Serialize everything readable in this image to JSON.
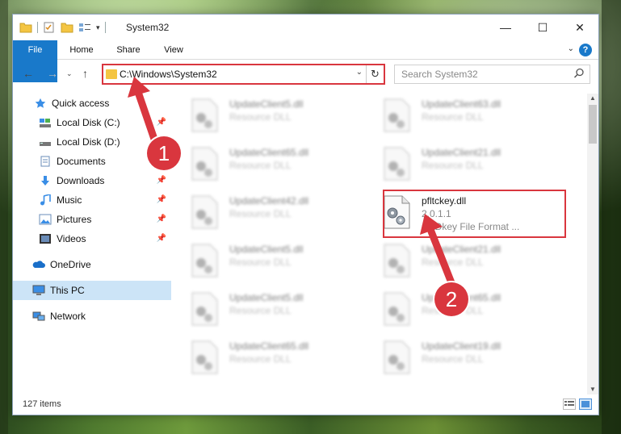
{
  "window": {
    "title": "System32",
    "controls": {
      "minimize": "—",
      "maximize": "☐",
      "close": "✕"
    }
  },
  "ribbon": {
    "tabs": [
      "File",
      "Home",
      "Share",
      "View"
    ],
    "help": "?"
  },
  "nav": {
    "address": "C:\\Windows\\System32",
    "search_placeholder": "Search System32"
  },
  "sidebar": {
    "items": [
      {
        "label": "Quick access",
        "icon": "star-icon"
      },
      {
        "label": "Local Disk (C:)",
        "icon": "drive-icon",
        "pinned": true
      },
      {
        "label": "Local Disk (D:)",
        "icon": "drive-icon"
      },
      {
        "label": "Documents",
        "icon": "documents-icon",
        "pinned": true
      },
      {
        "label": "Downloads",
        "icon": "download-icon",
        "pinned": true
      },
      {
        "label": "Music",
        "icon": "music-icon",
        "pinned": true
      },
      {
        "label": "Pictures",
        "icon": "pictures-icon",
        "pinned": true
      },
      {
        "label": "Videos",
        "icon": "videos-icon",
        "pinned": true
      },
      {
        "label": "OneDrive",
        "icon": "cloud-icon"
      },
      {
        "label": "This PC",
        "icon": "computer-icon",
        "selected": true
      },
      {
        "label": "Network",
        "icon": "network-icon"
      }
    ]
  },
  "files": [
    {
      "name": "UpdateClient5.dll",
      "desc": "Resource DLL"
    },
    {
      "name": "UpdateClient63.dll",
      "desc": "Resource DLL"
    },
    {
      "name": "UpdateClient65.dll",
      "desc": "Resource DLL"
    },
    {
      "name": "UpdateClient21.dll",
      "desc": "Resource DLL"
    },
    {
      "name": "UpdateClient42.dll",
      "desc": "Resource DLL"
    },
    {
      "name": "pfltckey.dll",
      "desc": "2.0.1.1",
      "desc2": "CADkey File Format ...",
      "highlighted": true
    },
    {
      "name": "UpdateClient5.dll",
      "desc": "Resource DLL"
    },
    {
      "name": "UpdateClient21.dll",
      "desc": "Resource DLL"
    },
    {
      "name": "UpdateClient5.dll",
      "desc": "Resource DLL"
    },
    {
      "name": "UpdateClient65.dll",
      "desc": "Resource DLL"
    },
    {
      "name": "UpdateClient65.dll",
      "desc": "Resource DLL"
    },
    {
      "name": "UpdateClient19.dll",
      "desc": "Resource DLL"
    }
  ],
  "status": {
    "item_count": "127 items"
  },
  "annotations": {
    "step1": "1",
    "step2": "2",
    "color": "#d9363e"
  }
}
